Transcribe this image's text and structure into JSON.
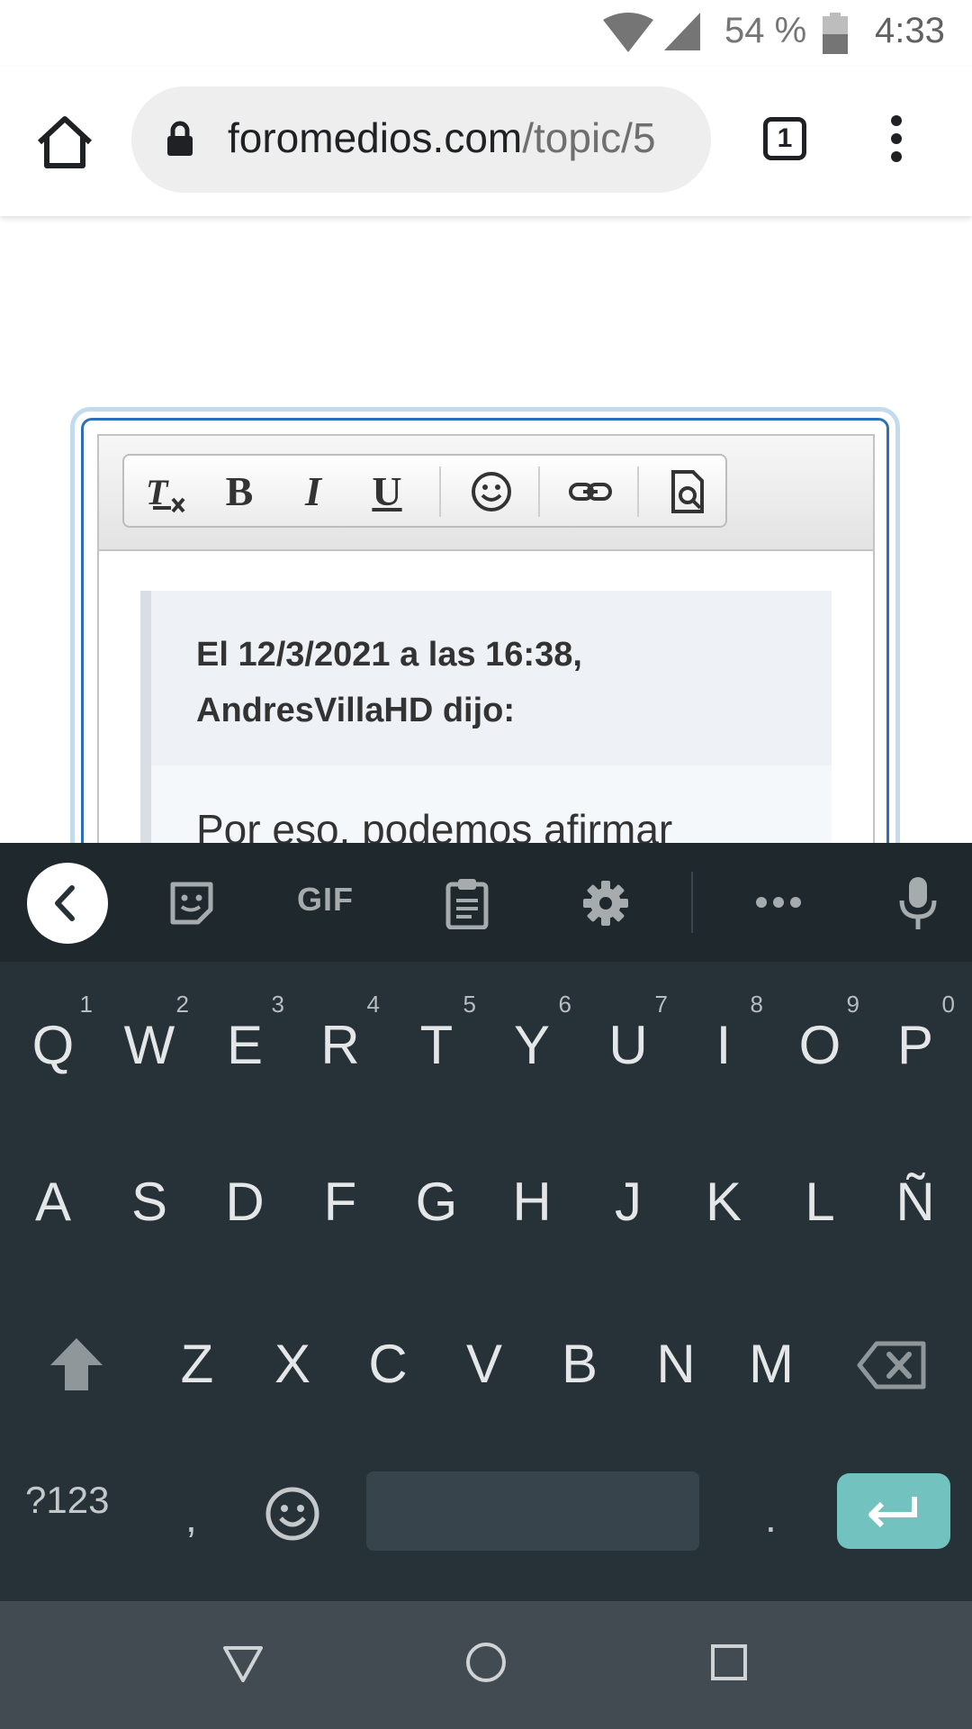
{
  "status_bar": {
    "battery_percent": "54 %",
    "time": "4:33"
  },
  "browser": {
    "url_host": "foromedios.com",
    "url_path": "/topic/5",
    "tab_count": "1"
  },
  "editor": {
    "toolbar": {
      "italic_label": "I",
      "bold_label": "B",
      "underline_label": "U"
    },
    "quote": {
      "header_line1": "El 12/3/2021 a las 16:38,",
      "header_line2": "AndresVillaHD dijo:",
      "body_text": "Por eso, podemos afirmar"
    }
  },
  "keyboard": {
    "toolbar": {
      "gif_label": "GIF"
    },
    "row1": [
      {
        "label": "Q",
        "hint": "1"
      },
      {
        "label": "W",
        "hint": "2"
      },
      {
        "label": "E",
        "hint": "3"
      },
      {
        "label": "R",
        "hint": "4"
      },
      {
        "label": "T",
        "hint": "5"
      },
      {
        "label": "Y",
        "hint": "6"
      },
      {
        "label": "U",
        "hint": "7"
      },
      {
        "label": "I",
        "hint": "8"
      },
      {
        "label": "O",
        "hint": "9"
      },
      {
        "label": "P",
        "hint": "0"
      }
    ],
    "row2": [
      "A",
      "S",
      "D",
      "F",
      "G",
      "H",
      "J",
      "K",
      "L",
      "Ñ"
    ],
    "row3": [
      "Z",
      "X",
      "C",
      "V",
      "B",
      "N",
      "M"
    ],
    "symbols_label": "?123",
    "comma_label": ",",
    "period_label": ".",
    "accent_color": "#72c2bf"
  }
}
